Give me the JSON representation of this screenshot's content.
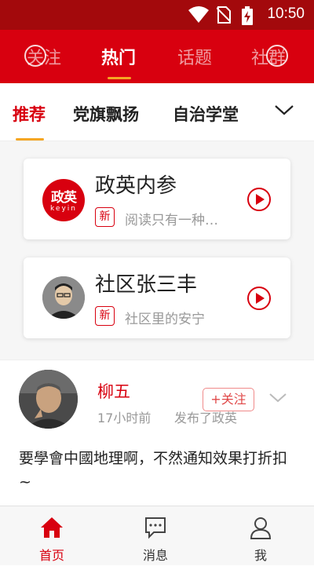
{
  "status_bar": {
    "time": "10:50",
    "icons": [
      "wifi-icon",
      "no-sim-icon",
      "battery-charging-icon"
    ]
  },
  "top_nav": {
    "tabs": [
      {
        "label": "关注",
        "active": false
      },
      {
        "label": "热门",
        "active": true
      },
      {
        "label": "话题",
        "active": false
      },
      {
        "label": "社群",
        "active": false
      }
    ]
  },
  "sub_nav": {
    "tabs": [
      {
        "label": "推荐",
        "active": true
      },
      {
        "label": "党旗飘扬",
        "active": false
      },
      {
        "label": "自治学堂",
        "active": false
      }
    ],
    "expand_icon": "chevron-down-icon"
  },
  "cards": [
    {
      "title": "政英内参",
      "badge": "新",
      "desc": "阅读只有一种…",
      "logo_text": "政英",
      "logo_sub": "keyin"
    },
    {
      "title": "社区张三丰",
      "badge": "新",
      "desc": "社区里的安宁"
    }
  ],
  "post": {
    "name": "柳五",
    "time": "17小时前",
    "action": "发布了政英",
    "follow_label": "+关注",
    "text": "要學會中國地理啊，不然通知效果打折扣 ~"
  },
  "bottom_nav": {
    "items": [
      {
        "label": "首页",
        "icon": "home-icon",
        "active": true
      },
      {
        "label": "消息",
        "icon": "message-icon",
        "active": false
      },
      {
        "label": "我",
        "icon": "profile-icon",
        "active": false
      }
    ]
  },
  "colors": {
    "brand_red": "#d8000f",
    "status_bar": "#a3090c",
    "accent_orange": "#f5a623"
  }
}
